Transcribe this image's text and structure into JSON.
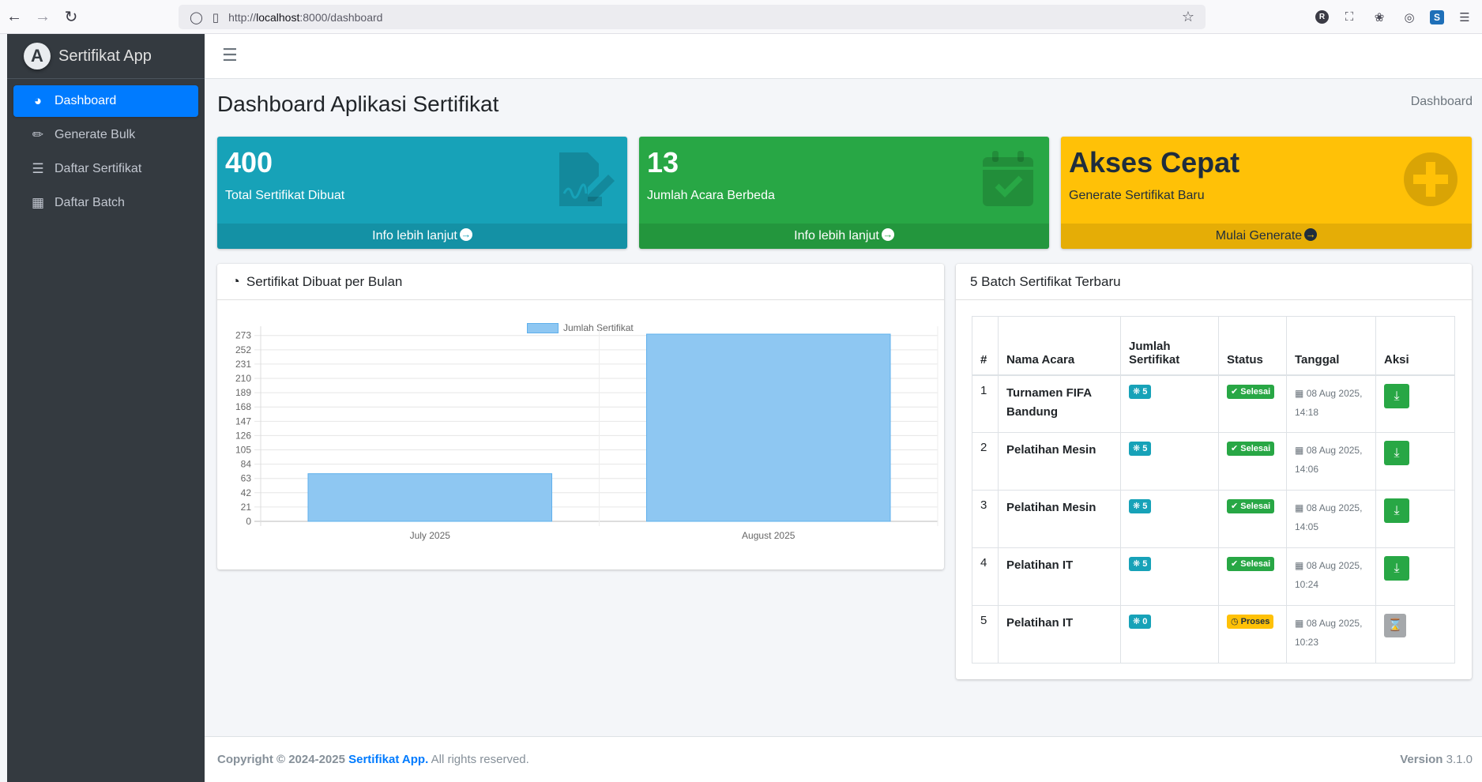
{
  "browser": {
    "url_prefix": "http://",
    "url_host": "localhost",
    "url_rest": ":8000/dashboard"
  },
  "sidebar": {
    "brand": "Sertifikat App",
    "items": [
      {
        "label": "Dashboard",
        "icon": "tachometer-icon"
      },
      {
        "label": "Generate Bulk",
        "icon": "file-export-icon"
      },
      {
        "label": "Daftar Sertifikat",
        "icon": "list-icon"
      },
      {
        "label": "Daftar Batch",
        "icon": "boxes-icon"
      }
    ]
  },
  "header": {
    "title": "Dashboard Aplikasi Sertifikat",
    "breadcrumb": "Dashboard"
  },
  "boxes": {
    "info": {
      "number": "400",
      "label": "Total Sertifikat Dibuat",
      "footer": "Info lebih lanjut",
      "color": "#17a2b8"
    },
    "success": {
      "number": "13",
      "label": "Jumlah Acara Berbeda",
      "footer": "Info lebih lanjut",
      "color": "#28a745"
    },
    "warning": {
      "number": "Akses Cepat",
      "label": "Generate Sertifikat Baru",
      "footer": "Mulai Generate",
      "color": "#ffc107"
    }
  },
  "chart_card": {
    "title": "Sertifikat Dibuat per Bulan"
  },
  "chart_data": {
    "type": "bar",
    "categories": [
      "July 2025",
      "August 2025"
    ],
    "series": [
      {
        "name": "Jumlah Sertifikat",
        "values": [
          70,
          275
        ]
      }
    ],
    "yticks": [
      0,
      21,
      42,
      63,
      84,
      105,
      126,
      147,
      168,
      189,
      210,
      231,
      252,
      273
    ],
    "ylim": [
      0,
      275
    ],
    "grid": true,
    "legend": "top",
    "bar_color": "#8ec7f2",
    "bar_border": "#5fb0ec"
  },
  "table_card": {
    "title": "5 Batch Sertifikat Terbaru",
    "headers": [
      "#",
      "Nama Acara",
      "Jumlah Sertifikat",
      "Status",
      "Tanggal",
      "Aksi"
    ],
    "rows": [
      {
        "no": "1",
        "nama": "Turnamen FIFA Bandung",
        "jumlah": "5",
        "status": "Selesai",
        "tanggal": "08 Aug 2025, 14:18",
        "action": "download"
      },
      {
        "no": "2",
        "nama": "Pelatihan Mesin",
        "jumlah": "5",
        "status": "Selesai",
        "tanggal": "08 Aug 2025, 14:06",
        "action": "download"
      },
      {
        "no": "3",
        "nama": "Pelatihan Mesin",
        "jumlah": "5",
        "status": "Selesai",
        "tanggal": "08 Aug 2025, 14:05",
        "action": "download"
      },
      {
        "no": "4",
        "nama": "Pelatihan IT",
        "jumlah": "5",
        "status": "Selesai",
        "tanggal": "08 Aug 2025, 10:24",
        "action": "download"
      },
      {
        "no": "5",
        "nama": "Pelatihan IT",
        "jumlah": "0",
        "status": "Proses",
        "tanggal": "08 Aug 2025, 10:23",
        "action": "waiting"
      }
    ]
  },
  "footer": {
    "copyright": "Copyright © 2024-2025",
    "app_link": "Sertifikat App.",
    "rights": " All rights reserved.",
    "version_label": "Version",
    "version": "3.1.0"
  }
}
